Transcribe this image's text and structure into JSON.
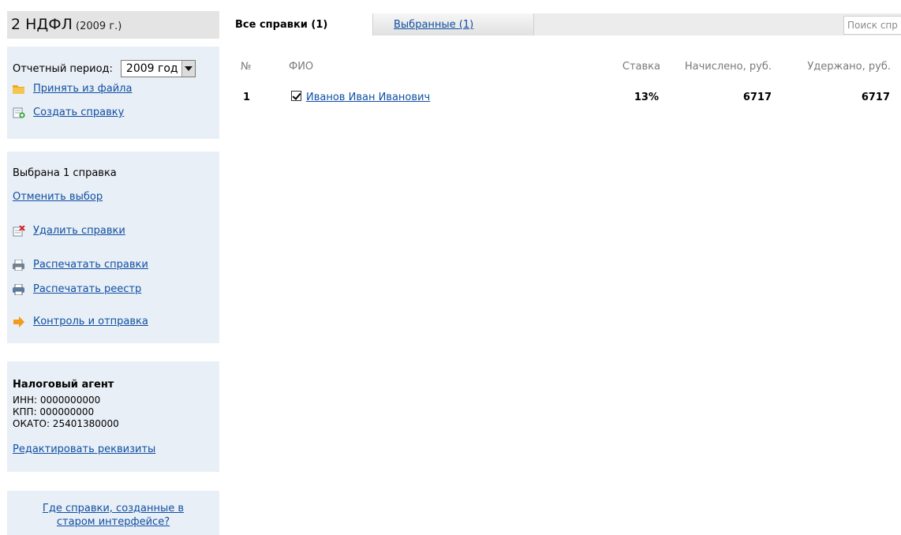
{
  "header": {
    "title": "2 НДФЛ",
    "year": "(2009 г.)"
  },
  "period": {
    "label": "Отчетный период:",
    "value": "2009 год",
    "import_link": "Принять из файла",
    "create_link": "Создать справку"
  },
  "selection": {
    "status": "Выбрана 1 справка",
    "cancel_link": "Отменить выбор",
    "delete_link": "Удалить справки",
    "print_link": "Распечатать справки",
    "print_registry_link": "Распечатать реестр",
    "control_link": "Контроль и отправка"
  },
  "agent": {
    "title": "Налоговый агент",
    "inn": "ИНН: 0000000000",
    "kpp": "КПП: 000000000",
    "okato": "ОКАТО: 25401380000",
    "edit_link": "Редактировать реквизиты"
  },
  "old_interface": {
    "line1": "Где справки, созданные в",
    "line2": "старом интерфейсе?"
  },
  "tabs": [
    {
      "label": "Все справки (1)",
      "active": true
    },
    {
      "label": "Выбранные (1)",
      "active": false
    }
  ],
  "search": {
    "placeholder": "Поиск спр"
  },
  "table": {
    "columns": [
      "№",
      "ФИО",
      "Ставка",
      "Начислено, руб.",
      "Удержано, руб."
    ],
    "rows": [
      {
        "num": "1",
        "checked": true,
        "name": "Иванов Иван Иванович",
        "rate": "13%",
        "accrued": "6717",
        "withheld": "6717"
      }
    ]
  },
  "colors": {
    "link": "#0f4fa3",
    "panel": "#e9eff6",
    "title_bg": "#e4e4e4",
    "tabs_bg": "#ececec"
  }
}
